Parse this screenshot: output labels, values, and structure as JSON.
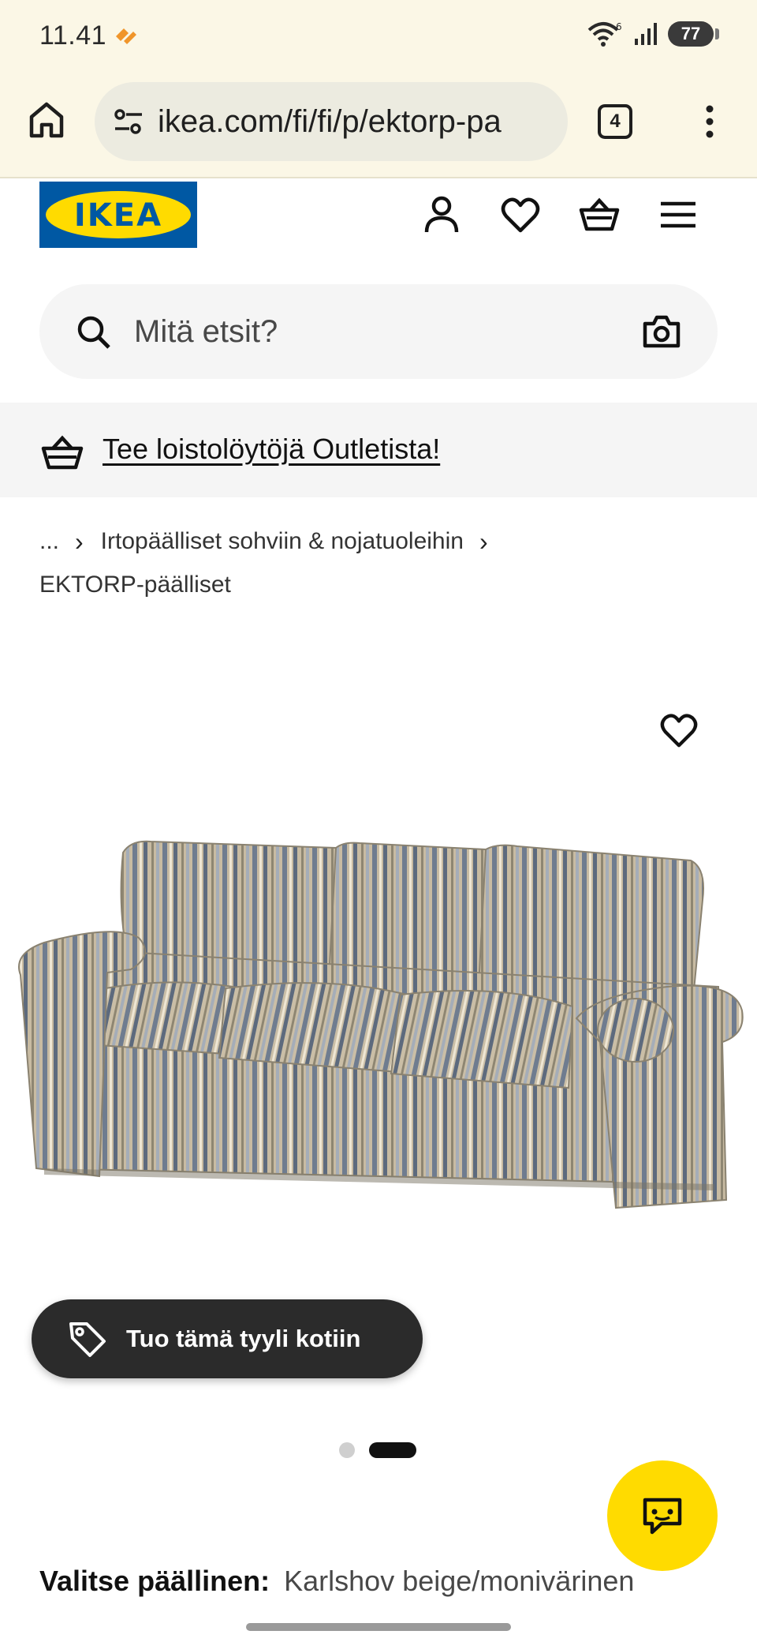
{
  "status_bar": {
    "time": "11.41",
    "battery": "77"
  },
  "browser": {
    "url": "ikea.com/fi/fi/p/ektorp-pa",
    "tab_count": "4"
  },
  "header": {
    "logo_text": "IKEA"
  },
  "search": {
    "placeholder": "Mitä etsit?"
  },
  "outlet_banner": {
    "text": "Tee loistolöytöjä Outletista!"
  },
  "breadcrumb": {
    "ellipsis": "...",
    "category": "Irtopäälliset sohviin & nojatuoleihin",
    "current": "EKTORP-päälliset"
  },
  "gallery": {
    "style_button_label": "Tuo tämä tyyli kotiin",
    "slide_count": 2,
    "active_slide": 2
  },
  "product": {
    "cover_label": "Valitse päällinen:",
    "cover_value": "Karlshov beige/monivärinen"
  },
  "colors": {
    "browser_bg": "#fbf7e6",
    "ikea_blue": "#0058a3",
    "ikea_yellow": "#ffdb00",
    "dark_button": "#2b2b2b"
  }
}
